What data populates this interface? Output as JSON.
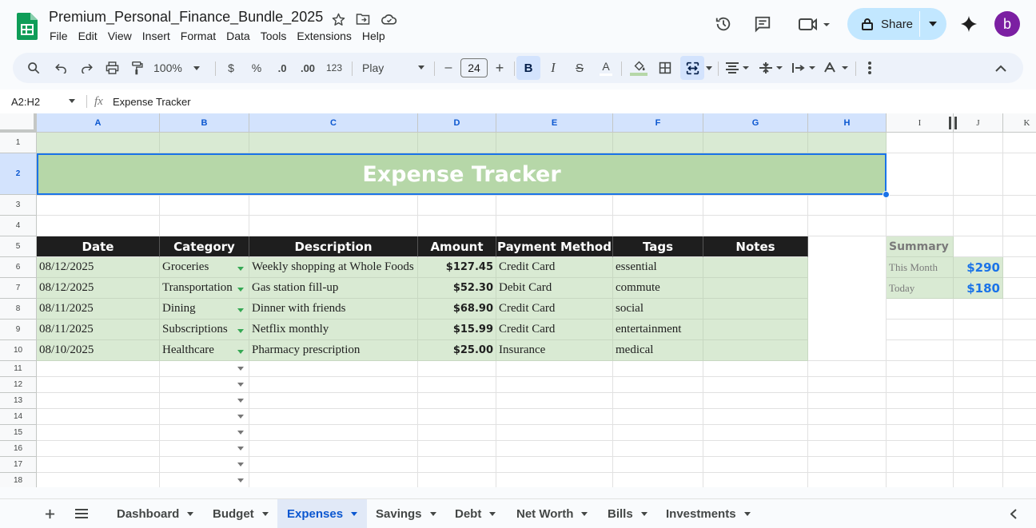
{
  "app": {
    "doc_title": "Premium_Personal_Finance_Bundle_2025",
    "menu": [
      "File",
      "Edit",
      "View",
      "Insert",
      "Format",
      "Data",
      "Tools",
      "Extensions",
      "Help"
    ],
    "share_label": "Share",
    "avatar_letter": "b"
  },
  "toolbar": {
    "zoom": "100%",
    "currency": "$",
    "percent": "%",
    "dec_decrease": ".0",
    "dec_increase": ".00",
    "format_123": "123",
    "font": "Play",
    "font_size": "24",
    "text_color_glyph": "A",
    "minus": "–",
    "plus": "+"
  },
  "formula_bar": {
    "name_box": "A2:H2",
    "fx": "fx",
    "content": "Expense Tracker"
  },
  "columns": [
    "A",
    "B",
    "C",
    "D",
    "E",
    "F",
    "G",
    "H",
    "I",
    "J",
    "K"
  ],
  "rows": [
    "1",
    "2",
    "3",
    "4",
    "5",
    "6",
    "7",
    "8",
    "9",
    "10",
    "11",
    "12",
    "13",
    "14",
    "15",
    "16",
    "17",
    "18"
  ],
  "sheet": {
    "title": "Expense Tracker",
    "headers": [
      "Date",
      "Category",
      "Description",
      "Amount",
      "Payment Method",
      "Tags",
      "Notes"
    ],
    "expenses": [
      {
        "date": "08/12/2025",
        "category": "Groceries",
        "description": "Weekly shopping at Whole Foods",
        "amount": "$127.45",
        "payment": "Credit Card",
        "tags": "essential",
        "notes": ""
      },
      {
        "date": "08/12/2025",
        "category": "Transportation",
        "description": "Gas station fill-up",
        "amount": "$52.30",
        "payment": "Debit Card",
        "tags": "commute",
        "notes": ""
      },
      {
        "date": "08/11/2025",
        "category": "Dining",
        "description": "Dinner with friends",
        "amount": "$68.90",
        "payment": "Credit Card",
        "tags": "social",
        "notes": ""
      },
      {
        "date": "08/11/2025",
        "category": "Subscriptions",
        "description": "Netflix monthly",
        "amount": "$15.99",
        "payment": "Credit Card",
        "tags": "entertainment",
        "notes": ""
      },
      {
        "date": "08/10/2025",
        "category": "Healthcare",
        "description": "Pharmacy prescription",
        "amount": "$25.00",
        "payment": "Insurance",
        "tags": "medical",
        "notes": ""
      }
    ],
    "summary": {
      "title": "Summary",
      "this_month_label": "This Month",
      "this_month_value": "$290",
      "today_label": "Today",
      "today_value": "$180"
    }
  },
  "tabs": [
    {
      "label": "Dashboard",
      "active": false
    },
    {
      "label": "Budget",
      "active": false
    },
    {
      "label": "Expenses",
      "active": true
    },
    {
      "label": "Savings",
      "active": false
    },
    {
      "label": "Debt",
      "active": false
    },
    {
      "label": "Net Worth",
      "active": false
    },
    {
      "label": "Bills",
      "active": false
    },
    {
      "label": "Investments",
      "active": false
    }
  ],
  "colors": {
    "accent": "#0b57d0",
    "sheet_green": "#d9ead3",
    "title_green": "#b6d7a8",
    "header_black": "#1e1e1e",
    "summary_blue": "#1a73e8"
  }
}
